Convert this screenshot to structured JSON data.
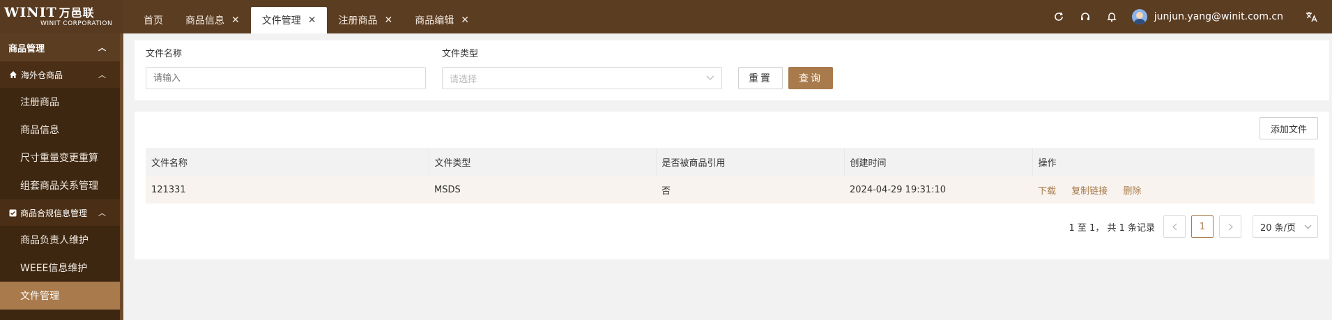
{
  "brand": {
    "logo_text": "WINIT",
    "logo_cn": "万邑联",
    "logo_sub": "WINIT CORPORATION"
  },
  "tabs": [
    {
      "label": "首页",
      "closable": false,
      "active": false
    },
    {
      "label": "商品信息",
      "closable": true,
      "active": false
    },
    {
      "label": "文件管理",
      "closable": true,
      "active": true
    },
    {
      "label": "注册商品",
      "closable": true,
      "active": false
    },
    {
      "label": "商品编辑",
      "closable": true,
      "active": false
    }
  ],
  "header": {
    "user_email": "junjun.yang@winit.com.cn",
    "icons": [
      "refresh-icon",
      "headset-icon",
      "bell-icon",
      "translate-icon"
    ]
  },
  "sidebar": {
    "group": "商品管理",
    "sections": [
      {
        "label": "海外仓商品",
        "icon": "home-icon",
        "items": [
          "注册商品",
          "商品信息",
          "尺寸重量变更重算",
          "组套商品关系管理"
        ]
      },
      {
        "label": "商品合规信息管理",
        "icon": "checkbox-icon",
        "items": [
          "商品负责人维护",
          "WEEE信息维护",
          "文件管理"
        ]
      }
    ],
    "active_item": "文件管理"
  },
  "filters": {
    "name_label": "文件名称",
    "name_placeholder": "请输入",
    "type_label": "文件类型",
    "type_placeholder": "请选择",
    "reset_label": "重置",
    "query_label": "查询"
  },
  "table": {
    "add_label": "添加文件",
    "columns": [
      "文件名称",
      "文件类型",
      "是否被商品引用",
      "创建时间",
      "操作"
    ],
    "rows": [
      {
        "name": "121331",
        "type": "MSDS",
        "referenced": "否",
        "created": "2024-04-29 19:31:10",
        "ops": [
          "下载",
          "复制链接",
          "删除"
        ]
      }
    ]
  },
  "pagination": {
    "summary": "1 至 1， 共 1 条记录",
    "current_page": "1",
    "page_size": "20 条/页"
  },
  "colors": {
    "header_bg": "#5b3d22",
    "sidebar_bg": "#3e2711",
    "accent": "#a87a4c"
  }
}
